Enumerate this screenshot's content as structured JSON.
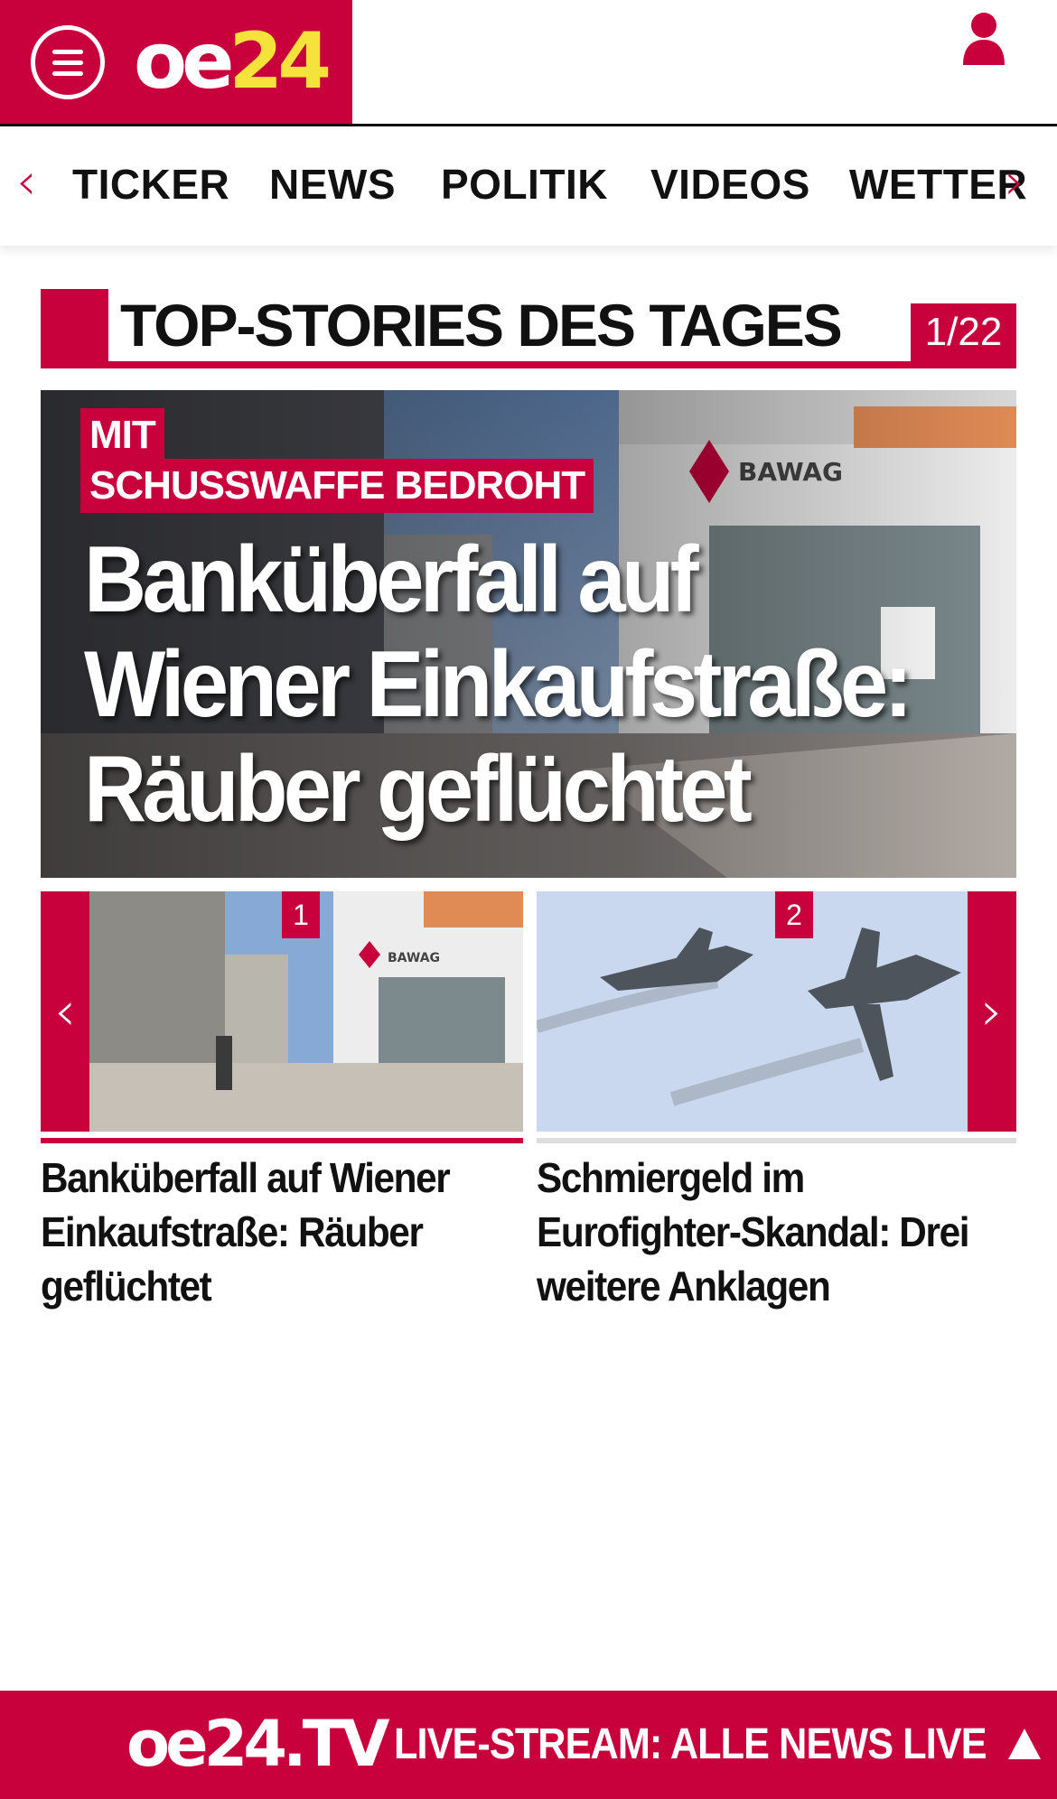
{
  "header": {
    "logo_part1": "oe",
    "logo_part2": "24",
    "menu_icon": "hamburger-menu-icon",
    "user_icon": "user-icon"
  },
  "nav": {
    "items": [
      "TICKER",
      "NEWS",
      "POLITIK",
      "VIDEOS",
      "WETTER"
    ],
    "prev_arrow": "‹",
    "next_arrow": "›"
  },
  "section": {
    "title": "TOP-STORIES DES TAGES",
    "counter": "1/22"
  },
  "hero": {
    "kicker_line1": "MIT",
    "kicker_line2": "SCHUSSWAFFE BEDROHT",
    "headline": "Banküberfall auf Wiener Einkaufstraße: Räuber geflüchtet"
  },
  "carousel": {
    "prev_arrow": "‹",
    "next_arrow": "›",
    "cards": [
      {
        "number": "1",
        "title": "Banküberfall auf Wiener Einkaufstraße: Räuber geflüchtet"
      },
      {
        "number": "2",
        "title": "Schmiergeld im Eurofighter-Skandal: Drei weitere Anklagen"
      }
    ]
  },
  "footer": {
    "logo": "oe24.TV",
    "text": "LIVE-STREAM:  ALLE NEWS LIVE",
    "scroll_top_icon": "arrow-up-icon"
  },
  "colors": {
    "brand_red": "#c8003c",
    "logo_yellow": "#f5e23b"
  }
}
